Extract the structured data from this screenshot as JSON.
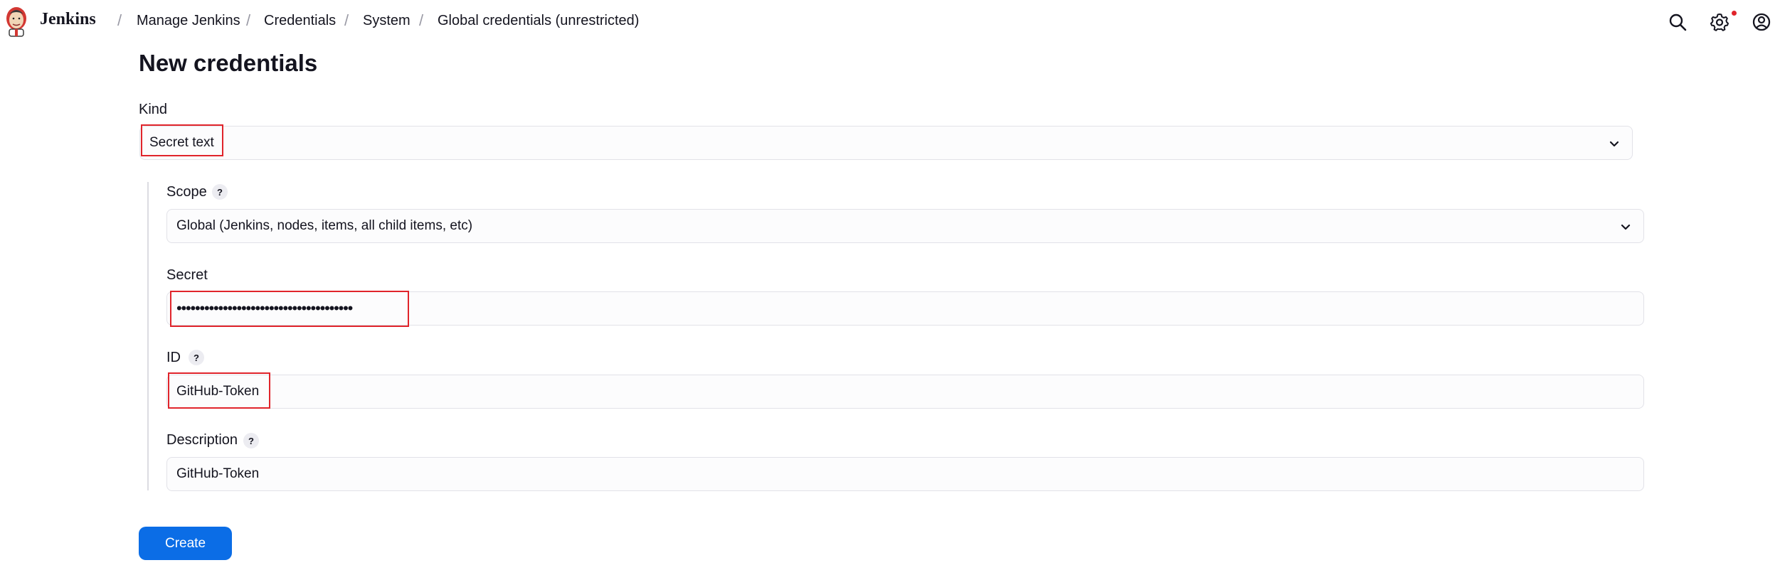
{
  "header": {
    "brand": "Jenkins",
    "breadcrumbs": [
      "Manage Jenkins",
      "Credentials",
      "System",
      "Global credentials (unrestricted)"
    ],
    "separator": "/",
    "icons": [
      "search-icon",
      "gear-icon",
      "user-icon"
    ],
    "notification_color": "#e0242b"
  },
  "page": {
    "title": "New credentials"
  },
  "form": {
    "kind": {
      "label": "Kind",
      "value": "Secret text"
    },
    "scope": {
      "label": "Scope",
      "help": "?",
      "value": "Global (Jenkins, nodes, items, all child items, etc)"
    },
    "secret": {
      "label": "Secret",
      "value": "••••••••••••••••••••••••••••••••••••••"
    },
    "id": {
      "label": "ID",
      "help": "?",
      "value": "GitHub-Token"
    },
    "description": {
      "label": "Description",
      "help": "?",
      "value": "GitHub-Token"
    }
  },
  "actions": {
    "create_label": "Create"
  },
  "colors": {
    "accent": "#0b6de6",
    "highlight": "#e0242b"
  }
}
